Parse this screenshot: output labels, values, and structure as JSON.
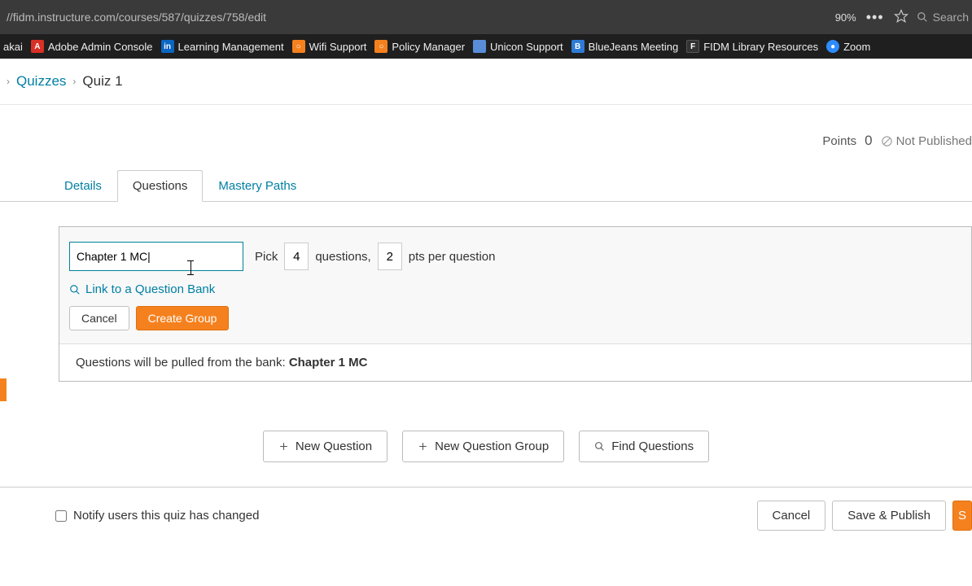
{
  "browser": {
    "url": "//fidm.instructure.com/courses/587/quizzes/758/edit",
    "zoom": "90%",
    "search_placeholder": "Search"
  },
  "bookmarks": [
    {
      "label": "akai"
    },
    {
      "label": "Adobe Admin Console"
    },
    {
      "label": "Learning Management"
    },
    {
      "label": "Wifi Support"
    },
    {
      "label": "Policy Manager"
    },
    {
      "label": "Unicon Support"
    },
    {
      "label": "BlueJeans Meeting"
    },
    {
      "label": "FIDM Library Resources"
    },
    {
      "label": "Zoom"
    }
  ],
  "breadcrumb": {
    "parent": "Quizzes",
    "current": "Quiz 1"
  },
  "summary": {
    "points_label": "Points",
    "points_value": "0",
    "publish_status": "Not Published"
  },
  "tabs": [
    {
      "label": "Details"
    },
    {
      "label": "Questions"
    },
    {
      "label": "Mastery Paths"
    }
  ],
  "group_editor": {
    "name_value": "Chapter 1 MC|",
    "pick_label": "Pick",
    "pick_value": "4",
    "questions_label": "questions,",
    "pts_value": "2",
    "pts_label": "pts per question",
    "link_bank": "Link to a Question Bank",
    "cancel": "Cancel",
    "create": "Create Group",
    "bank_info_prefix": "Questions will be pulled from the bank: ",
    "bank_name": "Chapter 1 MC"
  },
  "actions": {
    "new_question": "New Question",
    "new_group": "New Question Group",
    "find_questions": "Find Questions"
  },
  "bottom": {
    "notify_label": "Notify users this quiz has changed",
    "cancel": "Cancel",
    "save_publish": "Save & Publish",
    "save": "S"
  }
}
